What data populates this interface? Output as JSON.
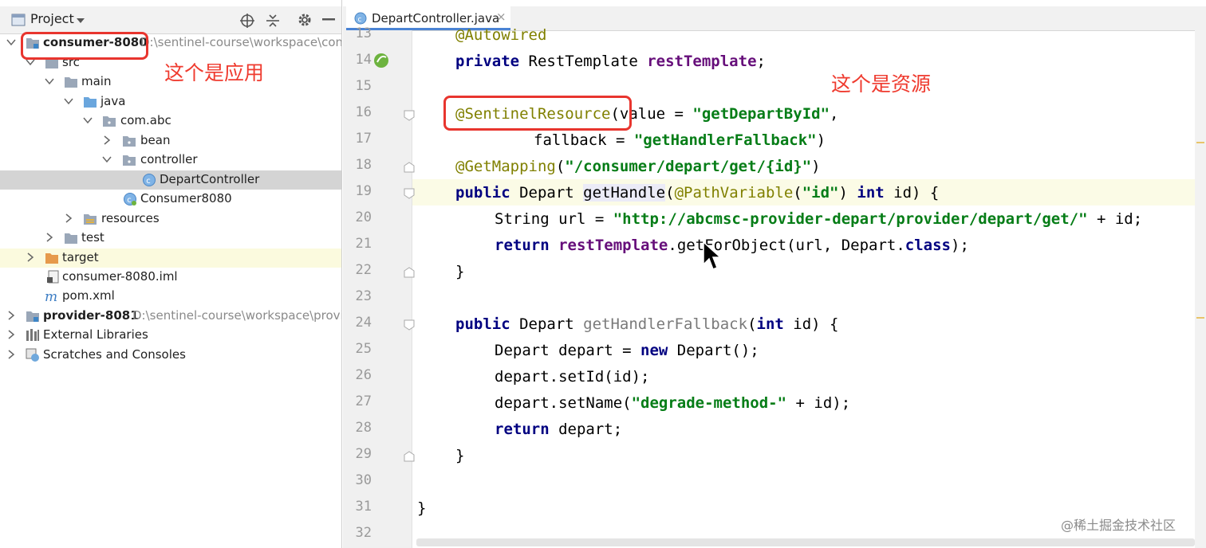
{
  "project_panel": {
    "title": "Project",
    "tree": [
      {
        "label": "consumer-8080",
        "path": "D:\\sentinel-course\\workspace\\consu"
      },
      {
        "label": "src"
      },
      {
        "label": "main"
      },
      {
        "label": "java"
      },
      {
        "label": "com.abc"
      },
      {
        "label": "bean"
      },
      {
        "label": "controller"
      },
      {
        "label": "DepartController"
      },
      {
        "label": "Consumer8080"
      },
      {
        "label": "resources"
      },
      {
        "label": "test"
      },
      {
        "label": "target"
      },
      {
        "label": "consumer-8080.iml"
      },
      {
        "label": "pom.xml"
      },
      {
        "label": "provider-8081",
        "path": "D:\\sentinel-course\\workspace\\provide"
      },
      {
        "label": "External Libraries"
      },
      {
        "label": "Scratches and Consoles"
      }
    ],
    "annotation": "这个是应用"
  },
  "editor": {
    "tab_label": "DepartController.java",
    "tab_close": "×",
    "annotation": "这个是资源",
    "line_numbers": [
      "13",
      "14",
      "15",
      "16",
      "17",
      "18",
      "19",
      "20",
      "21",
      "22",
      "23",
      "24",
      "25",
      "26",
      "27",
      "28",
      "29",
      "30",
      "31",
      "32"
    ],
    "code": {
      "l13": "@Autowired",
      "l14a": "private",
      "l14b": " RestTemplate ",
      "l14c": "restTemplate",
      "l14d": ";",
      "l16a": "@SentinelResource",
      "l16b": "(value = ",
      "l16c": "\"getDepartById\"",
      "l16d": ",",
      "l17a": "fallback = ",
      "l17b": "\"getHandlerFallback\"",
      "l17c": ")",
      "l18a": "@GetMapping",
      "l18b": "(",
      "l18c": "\"/consumer/depart/get/{id}\"",
      "l18d": ")",
      "l19a": "public",
      "l19b": " Depart ",
      "l19c": "getHandle",
      "l19d": "(",
      "l19e": "@PathVariable",
      "l19f": "(",
      "l19g": "\"id\"",
      "l19h": ") ",
      "l19i": "int",
      "l19j": " id) {",
      "l20a": "String url = ",
      "l20b": "\"http://abcmsc-provider-depart/provider/depart/get/\"",
      "l20c": " + id;",
      "l21a": "return",
      "l21b": " ",
      "l21c": "restTemplate",
      "l21d": ".getForObject(url, Depart.",
      "l21e": "class",
      "l21f": ");",
      "l22": "}",
      "l24a": "public",
      "l24b": " Depart ",
      "l24c": "getHandlerFallback",
      "l24d": "(",
      "l24e": "int",
      "l24f": " id) {",
      "l25a": "Depart depart = ",
      "l25b": "new",
      "l25c": " Depart();",
      "l26": "depart.setId(id);",
      "l27a": "depart.setName(",
      "l27b": "\"degrade-method-\"",
      "l27c": " + id);",
      "l28a": "return",
      "l28b": " depart;",
      "l29": "}",
      "l31": "}"
    }
  },
  "watermark": "@稀土掘金技术社区"
}
